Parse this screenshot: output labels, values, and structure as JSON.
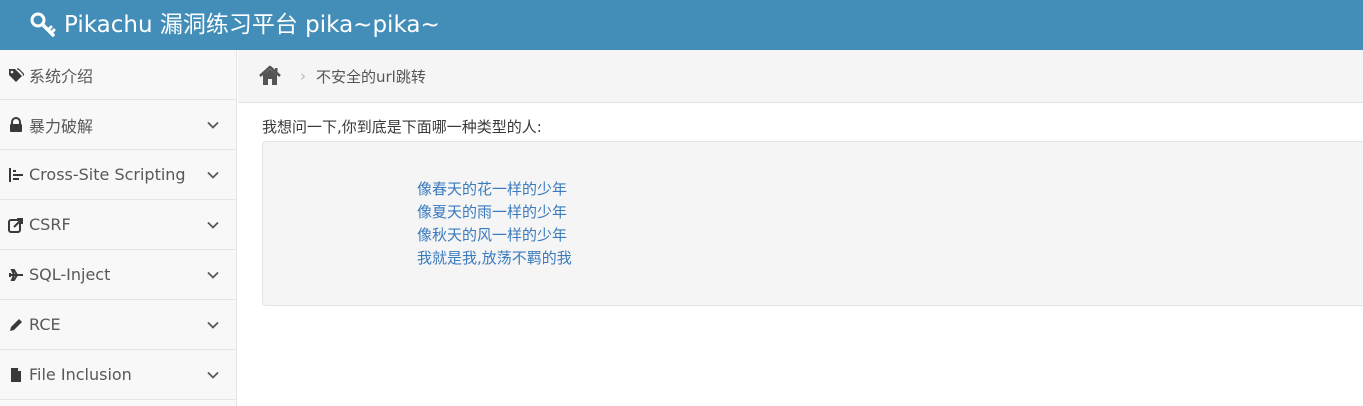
{
  "header": {
    "title": "Pikachu 漏洞练习平台 pika~pika~",
    "brand_icon": "key-icon",
    "color": "#438eb9"
  },
  "sidebar": {
    "items": [
      {
        "label": "系统介绍",
        "icon": "tags-icon",
        "expandable": false
      },
      {
        "label": "暴力破解",
        "icon": "lock-icon",
        "expandable": true
      },
      {
        "label": "Cross-Site Scripting",
        "icon": "indent-icon",
        "expandable": true
      },
      {
        "label": "CSRF",
        "icon": "share-icon",
        "expandable": true
      },
      {
        "label": "SQL-Inject",
        "icon": "plane-icon",
        "expandable": true
      },
      {
        "label": "RCE",
        "icon": "pencil-icon",
        "expandable": true
      },
      {
        "label": "File Inclusion",
        "icon": "file-icon",
        "expandable": true
      }
    ]
  },
  "breadcrumb": {
    "home_icon": "home-icon",
    "separator": "›",
    "current": "不安全的url跳转"
  },
  "main": {
    "question": "我想问一下,你到底是下面哪一种类型的人:",
    "links": [
      "像春天的花一样的少年",
      "像夏天的雨一样的少年",
      "像秋天的风一样的少年",
      "我就是我,放荡不羁的我"
    ],
    "link_color": "#3a7bbf"
  }
}
